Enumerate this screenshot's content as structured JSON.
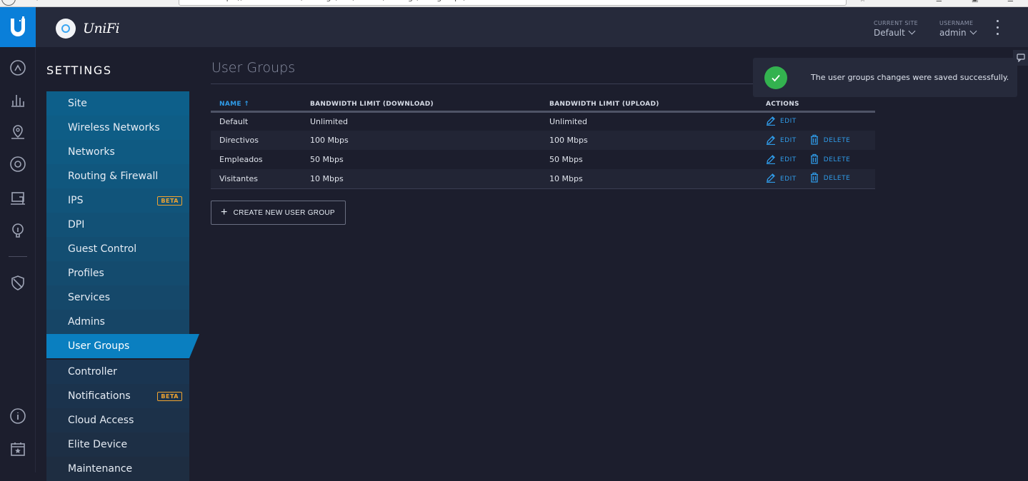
{
  "browser": {
    "url": "https://localhost:8443/manage/site/default/settings/usergroups/list"
  },
  "brand": {
    "name": "UniFi"
  },
  "topbar": {
    "current_site_label": "CURRENT SITE",
    "current_site_value": "Default",
    "username_label": "USERNAME",
    "username_value": "admin"
  },
  "rail_icons": [
    "dashboard-icon",
    "statistics-icon",
    "map-icon",
    "devices-icon",
    "clients-icon",
    "insights-icon",
    "shield-icon",
    "info-icon",
    "events-icon"
  ],
  "settings": {
    "title": "SETTINGS",
    "items": [
      {
        "label": "Site"
      },
      {
        "label": "Wireless Networks"
      },
      {
        "label": "Networks"
      },
      {
        "label": "Routing & Firewall"
      },
      {
        "label": "IPS",
        "badge": "BETA"
      },
      {
        "label": "DPI"
      },
      {
        "label": "Guest Control"
      },
      {
        "label": "Profiles"
      },
      {
        "label": "Services"
      },
      {
        "label": "Admins"
      },
      {
        "label": "User Groups",
        "active": true
      },
      {
        "label": "Controller"
      },
      {
        "label": "Notifications",
        "badge": "BETA"
      },
      {
        "label": "Cloud Access"
      },
      {
        "label": "Elite Device"
      },
      {
        "label": "Maintenance"
      }
    ]
  },
  "main": {
    "title": "User Groups",
    "columns": {
      "name": "NAME",
      "download": "BANDWIDTH LIMIT (DOWNLOAD)",
      "upload": "BANDWIDTH LIMIT (UPLOAD)",
      "actions": "ACTIONS"
    },
    "actions": {
      "edit": "EDIT",
      "delete": "DELETE"
    },
    "rows": [
      {
        "name": "Default",
        "download": "Unlimited",
        "upload": "Unlimited"
      },
      {
        "name": "Directivos",
        "download": "100 Mbps",
        "upload": "100 Mbps"
      },
      {
        "name": "Empleados",
        "download": "50 Mbps",
        "upload": "50 Mbps"
      },
      {
        "name": "Visitantes",
        "download": "10 Mbps",
        "upload": "10 Mbps"
      }
    ],
    "create_button": "CREATE NEW USER GROUP"
  },
  "toast": {
    "message": "The user groups changes were saved successfully."
  },
  "colors": {
    "accent": "#2f9be8",
    "active_nav": "#0a7fc0",
    "success": "#33b24f",
    "beta": "#f0a431"
  }
}
